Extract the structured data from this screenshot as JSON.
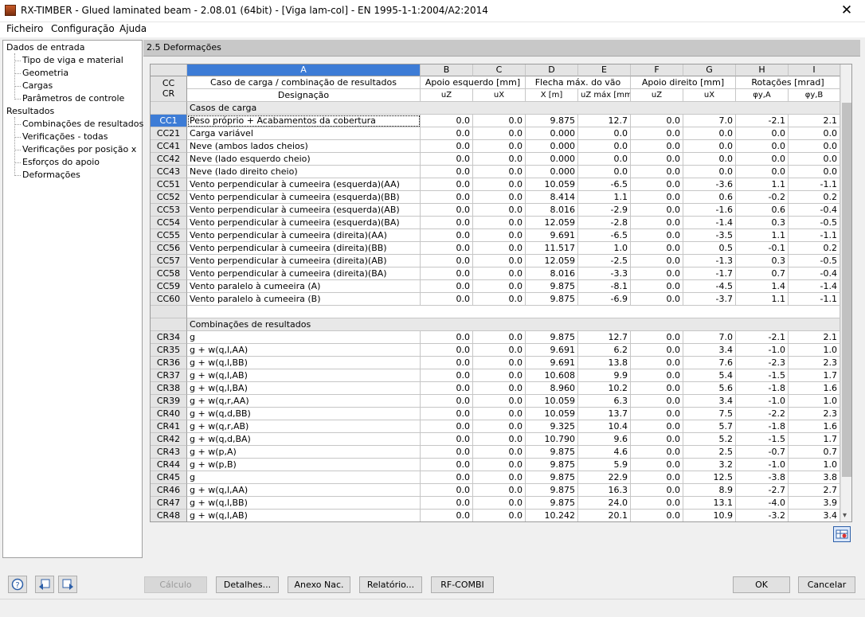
{
  "window": {
    "title": "RX-TIMBER - Glued laminated beam - 2.08.01 (64bit) - [Viga lam-col] - EN 1995-1-1:2004/A2:2014",
    "close": "✕"
  },
  "menu": [
    "Ficheiro",
    "Configuração",
    "Ajuda"
  ],
  "nav": {
    "input_group": "Dados de entrada",
    "input_items": [
      "Tipo de viga e material",
      "Geometria",
      "Cargas",
      "Parâmetros de controle"
    ],
    "results_group": "Resultados",
    "results_items": [
      "Combinações de resultados",
      "Verificações - todas",
      "Verificações por posição x",
      "Esforços do apoio",
      "Deformações"
    ],
    "selected": "Deformações"
  },
  "panel": {
    "title": "2.5 Deformações"
  },
  "table": {
    "col_letters": [
      "A",
      "B",
      "C",
      "D",
      "E",
      "F",
      "G",
      "H",
      "I"
    ],
    "rowhdr_title": [
      "CC",
      "CR"
    ],
    "hdr_a1": "Caso de carga / combinação de resultados",
    "hdr_a2": "Designação",
    "group_b": "Apoio esquerdo [mm]",
    "group_d": "Flecha máx. do vão",
    "group_f": "Apoio direito [mm]",
    "group_h": "Rotações [mrad]",
    "sub": [
      "uZ",
      "uX",
      "X [m]",
      "uZ máx [mm]",
      "uZ",
      "uX",
      "φy,A",
      "φy,B"
    ],
    "section_cc": "Casos de carga",
    "section_cr": "Combinações de resultados",
    "cc_rows": [
      [
        "CC1",
        "Peso próprio + Acabamentos da cobertura",
        "0.0",
        "0.0",
        "9.875",
        "12.7",
        "0.0",
        "7.0",
        "-2.1",
        "2.1"
      ],
      [
        "CC21",
        "Carga variável",
        "0.0",
        "0.0",
        "0.000",
        "0.0",
        "0.0",
        "0.0",
        "0.0",
        "0.0"
      ],
      [
        "CC41",
        "Neve (ambos lados cheios)",
        "0.0",
        "0.0",
        "0.000",
        "0.0",
        "0.0",
        "0.0",
        "0.0",
        "0.0"
      ],
      [
        "CC42",
        "Neve (lado esquerdo cheio)",
        "0.0",
        "0.0",
        "0.000",
        "0.0",
        "0.0",
        "0.0",
        "0.0",
        "0.0"
      ],
      [
        "CC43",
        "Neve (lado direito cheio)",
        "0.0",
        "0.0",
        "0.000",
        "0.0",
        "0.0",
        "0.0",
        "0.0",
        "0.0"
      ],
      [
        "CC51",
        "Vento perpendicular à cumeeira (esquerda)(AA)",
        "0.0",
        "0.0",
        "10.059",
        "-6.5",
        "0.0",
        "-3.6",
        "1.1",
        "-1.1"
      ],
      [
        "CC52",
        "Vento perpendicular à cumeeira (esquerda)(BB)",
        "0.0",
        "0.0",
        "8.414",
        "1.1",
        "0.0",
        "0.6",
        "-0.2",
        "0.2"
      ],
      [
        "CC53",
        "Vento perpendicular à cumeeira (esquerda)(AB)",
        "0.0",
        "0.0",
        "8.016",
        "-2.9",
        "0.0",
        "-1.6",
        "0.6",
        "-0.4"
      ],
      [
        "CC54",
        "Vento perpendicular à cumeeira (esquerda)(BA)",
        "0.0",
        "0.0",
        "12.059",
        "-2.8",
        "0.0",
        "-1.4",
        "0.3",
        "-0.5"
      ],
      [
        "CC55",
        "Vento perpendicular à cumeeira (direita)(AA)",
        "0.0",
        "0.0",
        "9.691",
        "-6.5",
        "0.0",
        "-3.5",
        "1.1",
        "-1.1"
      ],
      [
        "CC56",
        "Vento perpendicular à cumeeira (direita)(BB)",
        "0.0",
        "0.0",
        "11.517",
        "1.0",
        "0.0",
        "0.5",
        "-0.1",
        "0.2"
      ],
      [
        "CC57",
        "Vento perpendicular à cumeeira (direita)(AB)",
        "0.0",
        "0.0",
        "12.059",
        "-2.5",
        "0.0",
        "-1.3",
        "0.3",
        "-0.5"
      ],
      [
        "CC58",
        "Vento perpendicular à cumeeira (direita)(BA)",
        "0.0",
        "0.0",
        "8.016",
        "-3.3",
        "0.0",
        "-1.7",
        "0.7",
        "-0.4"
      ],
      [
        "CC59",
        "Vento paralelo à cumeeira (A)",
        "0.0",
        "0.0",
        "9.875",
        "-8.1",
        "0.0",
        "-4.5",
        "1.4",
        "-1.4"
      ],
      [
        "CC60",
        "Vento paralelo à cumeeira (B)",
        "0.0",
        "0.0",
        "9.875",
        "-6.9",
        "0.0",
        "-3.7",
        "1.1",
        "-1.1"
      ]
    ],
    "cr_rows": [
      [
        "CR34",
        "g",
        "0.0",
        "0.0",
        "9.875",
        "12.7",
        "0.0",
        "7.0",
        "-2.1",
        "2.1"
      ],
      [
        "CR35",
        "g + w(q,l,AA)",
        "0.0",
        "0.0",
        "9.691",
        "6.2",
        "0.0",
        "3.4",
        "-1.0",
        "1.0"
      ],
      [
        "CR36",
        "g + w(q,l,BB)",
        "0.0",
        "0.0",
        "9.691",
        "13.8",
        "0.0",
        "7.6",
        "-2.3",
        "2.3"
      ],
      [
        "CR37",
        "g + w(q,l,AB)",
        "0.0",
        "0.0",
        "10.608",
        "9.9",
        "0.0",
        "5.4",
        "-1.5",
        "1.7"
      ],
      [
        "CR38",
        "g + w(q,l,BA)",
        "0.0",
        "0.0",
        "8.960",
        "10.2",
        "0.0",
        "5.6",
        "-1.8",
        "1.6"
      ],
      [
        "CR39",
        "g + w(q,r,AA)",
        "0.0",
        "0.0",
        "10.059",
        "6.3",
        "0.0",
        "3.4",
        "-1.0",
        "1.0"
      ],
      [
        "CR40",
        "g + w(q,d,BB)",
        "0.0",
        "0.0",
        "10.059",
        "13.7",
        "0.0",
        "7.5",
        "-2.2",
        "2.3"
      ],
      [
        "CR41",
        "g + w(q,r,AB)",
        "0.0",
        "0.0",
        "9.325",
        "10.4",
        "0.0",
        "5.7",
        "-1.8",
        "1.6"
      ],
      [
        "CR42",
        "g + w(q,d,BA)",
        "0.0",
        "0.0",
        "10.790",
        "9.6",
        "0.0",
        "5.2",
        "-1.5",
        "1.7"
      ],
      [
        "CR43",
        "g + w(p,A)",
        "0.0",
        "0.0",
        "9.875",
        "4.6",
        "0.0",
        "2.5",
        "-0.7",
        "0.7"
      ],
      [
        "CR44",
        "g + w(p,B)",
        "0.0",
        "0.0",
        "9.875",
        "5.9",
        "0.0",
        "3.2",
        "-1.0",
        "1.0"
      ],
      [
        "CR45",
        "g",
        "0.0",
        "0.0",
        "9.875",
        "22.9",
        "0.0",
        "12.5",
        "-3.8",
        "3.8"
      ],
      [
        "CR46",
        "g + w(q,l,AA)",
        "0.0",
        "0.0",
        "9.875",
        "16.3",
        "0.0",
        "8.9",
        "-2.7",
        "2.7"
      ],
      [
        "CR47",
        "g + w(q,l,BB)",
        "0.0",
        "0.0",
        "9.875",
        "24.0",
        "0.0",
        "13.1",
        "-4.0",
        "3.9"
      ],
      [
        "CR48",
        "g + w(q,l,AB)",
        "0.0",
        "0.0",
        "10.242",
        "20.1",
        "0.0",
        "10.9",
        "-3.2",
        "3.4"
      ]
    ]
  },
  "buttons": {
    "calc": "Cálculo",
    "details": "Detalhes...",
    "annex": "Anexo Nac.",
    "report": "Relatório...",
    "rfcombi": "RF-COMBI",
    "ok": "OK",
    "cancel": "Cancelar"
  },
  "icons": {
    "help": "help-icon",
    "prev": "prev-window-icon",
    "next": "next-window-icon",
    "export": "export-table-icon"
  }
}
